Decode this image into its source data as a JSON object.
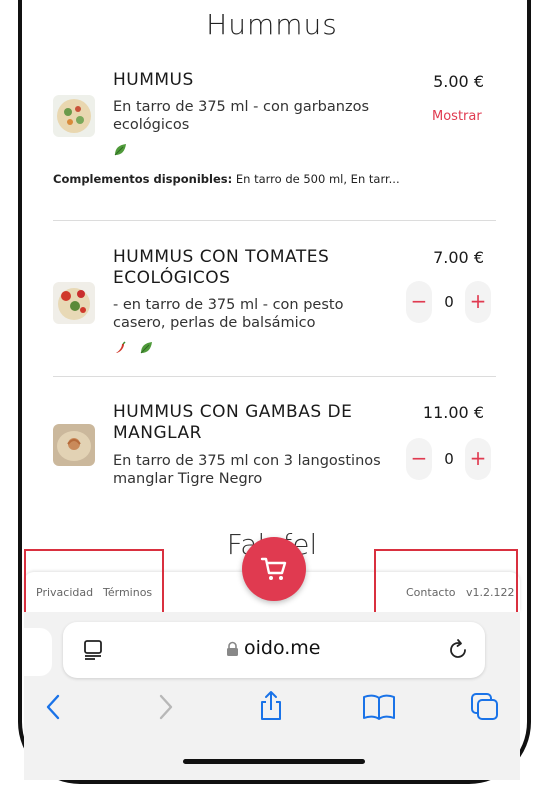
{
  "section": {
    "title": "Hummus"
  },
  "items": [
    {
      "name": "HUMMUS",
      "description": "En tarro de 375 ml - con garbanzos ecológicos",
      "price": "5.00 €",
      "action": "Mostrar",
      "tags": [
        "leaf"
      ],
      "complements_label": "Complementos disponibles:",
      "complements_value": " En tarro de 500 ml, En tarr..."
    },
    {
      "name": "HUMMUS CON TOMATES ECOLÓGICOS",
      "description": "- en tarro de 375 ml - con pesto casero, perlas de balsámico",
      "price": "7.00 €",
      "qty": "0",
      "tags": [
        "chili",
        "leaf"
      ]
    },
    {
      "name": "HUMMUS CON GAMBAS DE MANGLAR",
      "description": "En tarro de 375 ml con 3 langostinos manglar Tigre Negro",
      "price": "11.00 €",
      "qty": "0"
    }
  ],
  "next_section": {
    "title": "Falafel"
  },
  "footer": {
    "privacy": "Privacidad",
    "terms": "Términos",
    "contact": "Contacto",
    "version": "v1.2.122"
  },
  "browser": {
    "url": "oido.me"
  },
  "icons": [
    "cart-icon",
    "reader-icon",
    "lock-icon",
    "reload-icon",
    "back-icon",
    "forward-icon",
    "share-icon",
    "bookmarks-icon",
    "tabs-icon"
  ],
  "colors": {
    "accent": "#e03a50",
    "highlight": "#d9303f"
  }
}
